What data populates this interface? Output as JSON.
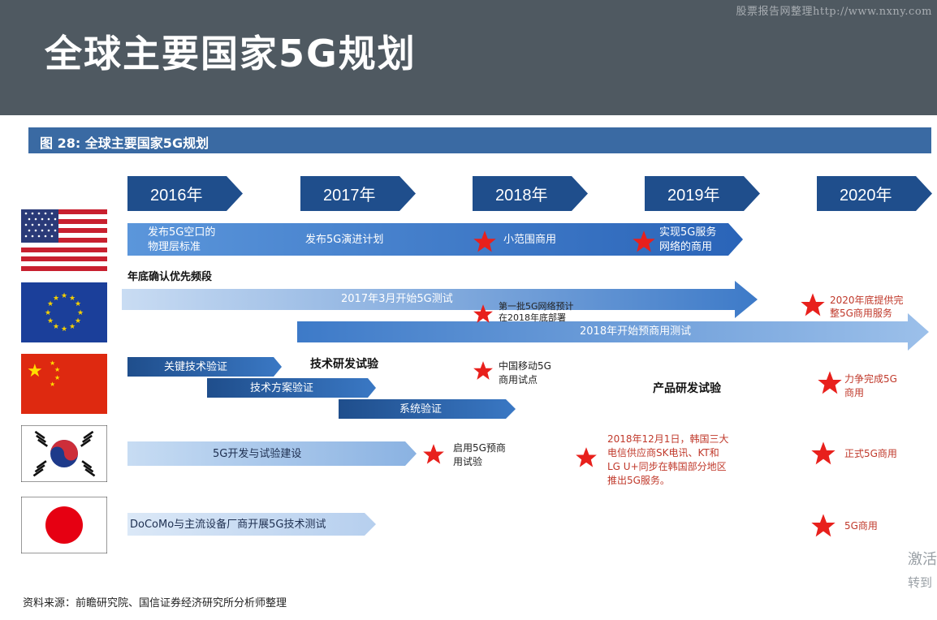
{
  "header": {
    "title": "全球主要国家5G规划",
    "watermark": "股票报告网整理http://www.nxny.com"
  },
  "figure": {
    "label": "图 28:  全球主要国家5G规划"
  },
  "years": [
    "2016年",
    "2017年",
    "2018年",
    "2019年",
    "2020年"
  ],
  "usa": {
    "a1": "发布5G空口的",
    "a2": "物理层标准",
    "b": "发布5G演进计划",
    "c": "小范围商用",
    "d1": "实现5G服务",
    "d2": "网络的商用"
  },
  "eu": {
    "heading": "年底确认优先频段",
    "test": "2017年3月开始5G测试",
    "wave1": "第一批5G网络预计",
    "wave2": "在2018年底部署",
    "precommercial": "2018年开始预商用测试",
    "full1": "2020年底提供完",
    "full2": "整5G商用服务"
  },
  "china": {
    "s1": "关键技术验证",
    "s2": "技术方案验证",
    "s3": "系统验证",
    "phase1": "技术研发试验",
    "cm1": "中国移动5G",
    "cm2": "商用试点",
    "phase2": "产品研发试验",
    "goal1": "力争完成5G",
    "goal2": "商用"
  },
  "korea": {
    "build": "5G开发与试验建设",
    "pre1": "启用5G预商",
    "pre2": "用试验",
    "n1": "2018年12月1日，韩国三大",
    "n2": "电信供应商SK电讯、KT和",
    "n3": "LG U+同步在韩国部分地区",
    "n4": "推出5G服务。",
    "formal": "正式5G商用"
  },
  "japan": {
    "test": "DoCoMo与主流设备厂商开展5G技术测试",
    "commercial": "5G商用"
  },
  "source": "资料来源：前瞻研究院、国信证券经济研究所分析师整理",
  "overlay": {
    "l1": "激活",
    "l2": "转到"
  },
  "colors": {
    "header": "#4f5961",
    "figure_bar": "#3a6aa3",
    "year_chevron": "#1f4e8c",
    "star": "#e8201c",
    "annotation": "#c0392b"
  }
}
